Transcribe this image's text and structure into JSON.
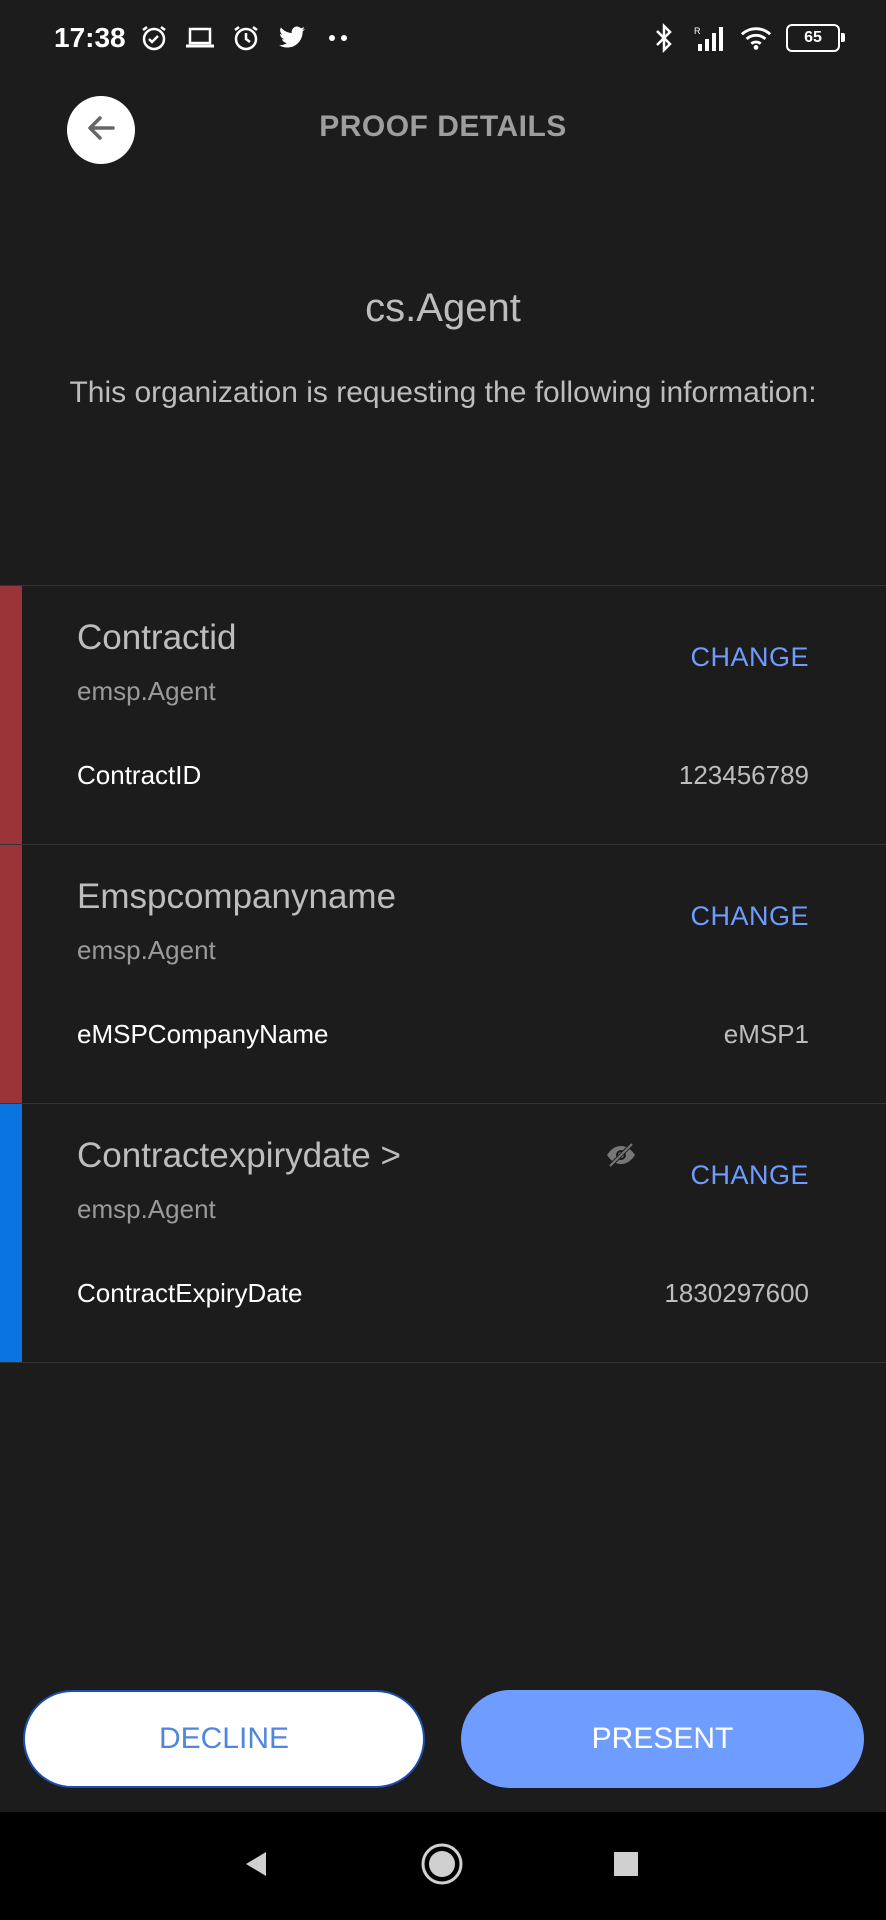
{
  "status_bar": {
    "time": "17:38",
    "left_icons": [
      "alarm-check-icon",
      "laptop-icon",
      "alarm-icon",
      "twitter-icon",
      "more-dots-icon"
    ],
    "right_icons": [
      "bluetooth-icon",
      "signal-icon",
      "wifi-icon",
      "battery-icon"
    ],
    "battery": "65"
  },
  "header": {
    "title": "PROOF DETAILS",
    "back_icon": "arrow-left-icon"
  },
  "organization": {
    "name": "cs.Agent",
    "description": "This organization is requesting the following information:"
  },
  "credentials": [
    {
      "title": "Contractid",
      "issuer": "emsp.Agent",
      "change_label": "CHANGE",
      "attribute_name": "ContractID",
      "attribute_value": "123456789",
      "bar_color": "#9b3439",
      "hidden_icon": false
    },
    {
      "title": "Emspcompanyname",
      "issuer": "emsp.Agent",
      "change_label": "CHANGE",
      "attribute_name": "eMSPCompanyName",
      "attribute_value": "eMSP1",
      "bar_color": "#9b3439",
      "hidden_icon": false
    },
    {
      "title": "Contractexpirydate >",
      "issuer": "emsp.Agent",
      "change_label": "CHANGE",
      "attribute_name": "ContractExpiryDate",
      "attribute_value": "1830297600",
      "bar_color": "#0a74e0",
      "hidden_icon": true
    }
  ],
  "actions": {
    "decline_label": "DECLINE",
    "present_label": "PRESENT"
  },
  "colors": {
    "background": "#1c1c1d",
    "accent": "#6f9cff",
    "error_bar": "#9b3439",
    "predicate_bar": "#0a74e0"
  }
}
